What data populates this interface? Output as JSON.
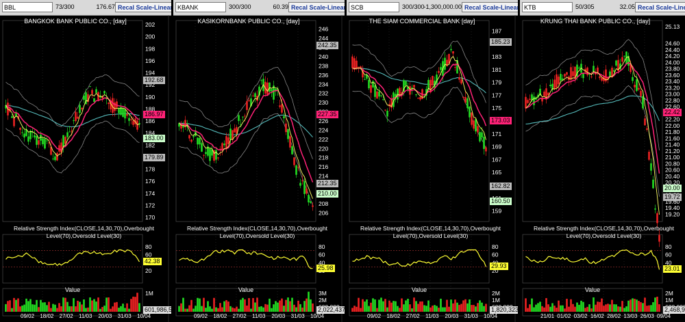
{
  "colors": {
    "up": "#22dd22",
    "down": "#ee2222",
    "ema_fast": "#ffff66",
    "ema_mid": "#ff2277",
    "ema_long": "#55bbbb",
    "band": "#888888",
    "rsi": "#ffff33",
    "ob_line": "#aa3333"
  },
  "panels": [
    {
      "symbol": "BBL",
      "count": "73/300",
      "last": "176.67",
      "recal": "Recal Scale-Linear",
      "title": "BANGKOK BANK PUBLIC CO., [day]",
      "price_axis": [
        "202",
        "200",
        "198",
        "196",
        "194",
        "192",
        "190",
        "188",
        "186",
        "184",
        "182",
        "180",
        "178",
        "176",
        "174",
        "172",
        "170"
      ],
      "price_min": 170,
      "price_max": 202,
      "tags": [
        {
          "text": "192.68",
          "y": 192.68,
          "bg": "#bbbbbb"
        },
        {
          "text": "186.97",
          "y": 186.97,
          "bg": "#ff2277"
        },
        {
          "text": "183.00",
          "y": 183.0,
          "bg": "#ccffcc"
        },
        {
          "text": "179.89",
          "y": 179.89,
          "bg": "#bbbbbb"
        }
      ],
      "series_seed": 1,
      "start": 188.5,
      "trend": [
        0,
        -4,
        -6,
        -8,
        -3,
        2,
        1,
        -1,
        -3
      ],
      "rsi_label": "Relative Strength Index(CLOSE,14,30,70),Overbought Level(70),Oversold Level(30)",
      "rsi_axis": [
        "80",
        "60",
        "40",
        "20"
      ],
      "rsi_value": "42.38",
      "vol_label": "Value",
      "vol_axis": [
        "1M"
      ],
      "vol_value": "601,986,5",
      "dates": [
        "09/02",
        "18/02",
        "27/02",
        "11/03",
        "20/03",
        "31/03",
        "10/04"
      ]
    },
    {
      "symbol": "KBANK",
      "count": "300/300",
      "last": "60.39",
      "recal": "Recal Scale-Linear",
      "title": "KASIKORNBANK PUBLIC CO., [day]",
      "price_axis": [
        "246",
        "244",
        "242",
        "240",
        "238",
        "236",
        "234",
        "232",
        "230",
        "228",
        "226",
        "224",
        "222",
        "220",
        "218",
        "216",
        "214",
        "212",
        "210",
        "208",
        "206"
      ],
      "price_min": 205,
      "price_max": 247,
      "tags": [
        {
          "text": "242.35",
          "y": 242.35,
          "bg": "#bbbbbb"
        },
        {
          "text": "227.35",
          "y": 227.35,
          "bg": "#ff2277"
        },
        {
          "text": "212.35",
          "y": 212.35,
          "bg": "#bbbbbb"
        },
        {
          "text": "210.00",
          "y": 210.0,
          "bg": "#ccffcc"
        }
      ],
      "series_seed": 2,
      "start": 226,
      "trend": [
        0,
        -3,
        -6,
        -3,
        2,
        6,
        4,
        -8,
        -14
      ],
      "rsi_label": "Relative Strength Index(CLOSE,14,30,70),Overbought Level(70),Oversold Level(30)",
      "rsi_axis": [
        "80",
        "60",
        "40",
        "20"
      ],
      "rsi_value": "25.98",
      "vol_label": "Value",
      "vol_axis": [
        "3M",
        "2M",
        "600,000"
      ],
      "vol_value": "2,022,437",
      "dates": [
        "09/02",
        "18/02",
        "27/02",
        "11/03",
        "20/03",
        "31/03",
        "10/04"
      ]
    },
    {
      "symbol": "SCB",
      "count": "300/300",
      "last": "-1,300,000.00",
      "recal": "Recal Scale-Linear",
      "title": "THE SIAM COMMERCIAL BANK [day]",
      "price_axis": [
        "187",
        "185",
        "183",
        "181",
        "179",
        "177",
        "175",
        "173",
        "171",
        "169",
        "167",
        "165",
        "163",
        "161",
        "159"
      ],
      "price_min": 158,
      "price_max": 188,
      "tags": [
        {
          "text": "185.23",
          "y": 185.23,
          "bg": "#bbbbbb"
        },
        {
          "text": "173.03",
          "y": 173.03,
          "bg": "#ff2277"
        },
        {
          "text": "162.82",
          "y": 162.82,
          "bg": "#bbbbbb"
        },
        {
          "text": "160.50",
          "y": 160.5,
          "bg": "#ccffcc"
        }
      ],
      "series_seed": 3,
      "start": 182,
      "trend": [
        0,
        -3,
        -8,
        -4,
        -5,
        -3,
        2,
        -8,
        -14
      ],
      "rsi_label": "Relative Strength Index(CLOSE,14,30,70),Overbought Level(70),Oversold Level(30)",
      "rsi_axis": [
        "80",
        "60",
        "40",
        "20"
      ],
      "rsi_value": "29.93",
      "vol_label": "Value",
      "vol_axis": [
        "2M",
        "1M",
        "600,000"
      ],
      "vol_value": "1,820,323",
      "dates": [
        "09/02",
        "18/02",
        "27/02",
        "11/03",
        "20/03",
        "31/03",
        "10/04"
      ]
    },
    {
      "symbol": "KTB",
      "count": "50/305",
      "last": "32.05",
      "recal": "Recal Scale-Linear",
      "title": "KRUNG THAI BANK PUBLIC CO., [day]",
      "price_axis": [
        "25.13",
        "24.60",
        "24.40",
        "24.20",
        "24.00",
        "23.80",
        "23.60",
        "23.40",
        "23.20",
        "23.00",
        "22.80",
        "22.60",
        "22.40",
        "22.20",
        "22.00",
        "21.80",
        "21.60",
        "21.40",
        "21.20",
        "21.00",
        "20.80",
        "20.60",
        "20.40",
        "20.20",
        "20.00",
        "19.80",
        "19.60",
        "19.40",
        "19.20"
      ],
      "price_min": 19.1,
      "price_max": 25.2,
      "tags": [
        {
          "text": "22.42",
          "y": 22.42,
          "bg": "#ff2277"
        },
        {
          "text": "20.00",
          "y": 20.0,
          "bg": "#ccffcc"
        },
        {
          "text": "19.72",
          "y": 19.72,
          "bg": "#bbbbbb"
        }
      ],
      "series_seed": 4,
      "start": 22.8,
      "trend": [
        0,
        0.1,
        0.5,
        0.6,
        0.6,
        0.5,
        0.9,
        0,
        -2.8
      ],
      "rsi_label": "Relative Strength Index(CLOSE,14,30,70),Overbought Level(70),Oversold Level(30)",
      "rsi_axis": [
        "80",
        "60",
        "40",
        "20"
      ],
      "rsi_value": "23.01",
      "vol_label": "Value",
      "vol_axis": [
        "2M",
        "1M",
        "600,000"
      ],
      "vol_value": "2,468,999",
      "dates": [
        "21/01",
        "01/02",
        "03/02",
        "16/02",
        "28/02",
        "13/03",
        "26/03",
        "09/04"
      ]
    }
  ]
}
